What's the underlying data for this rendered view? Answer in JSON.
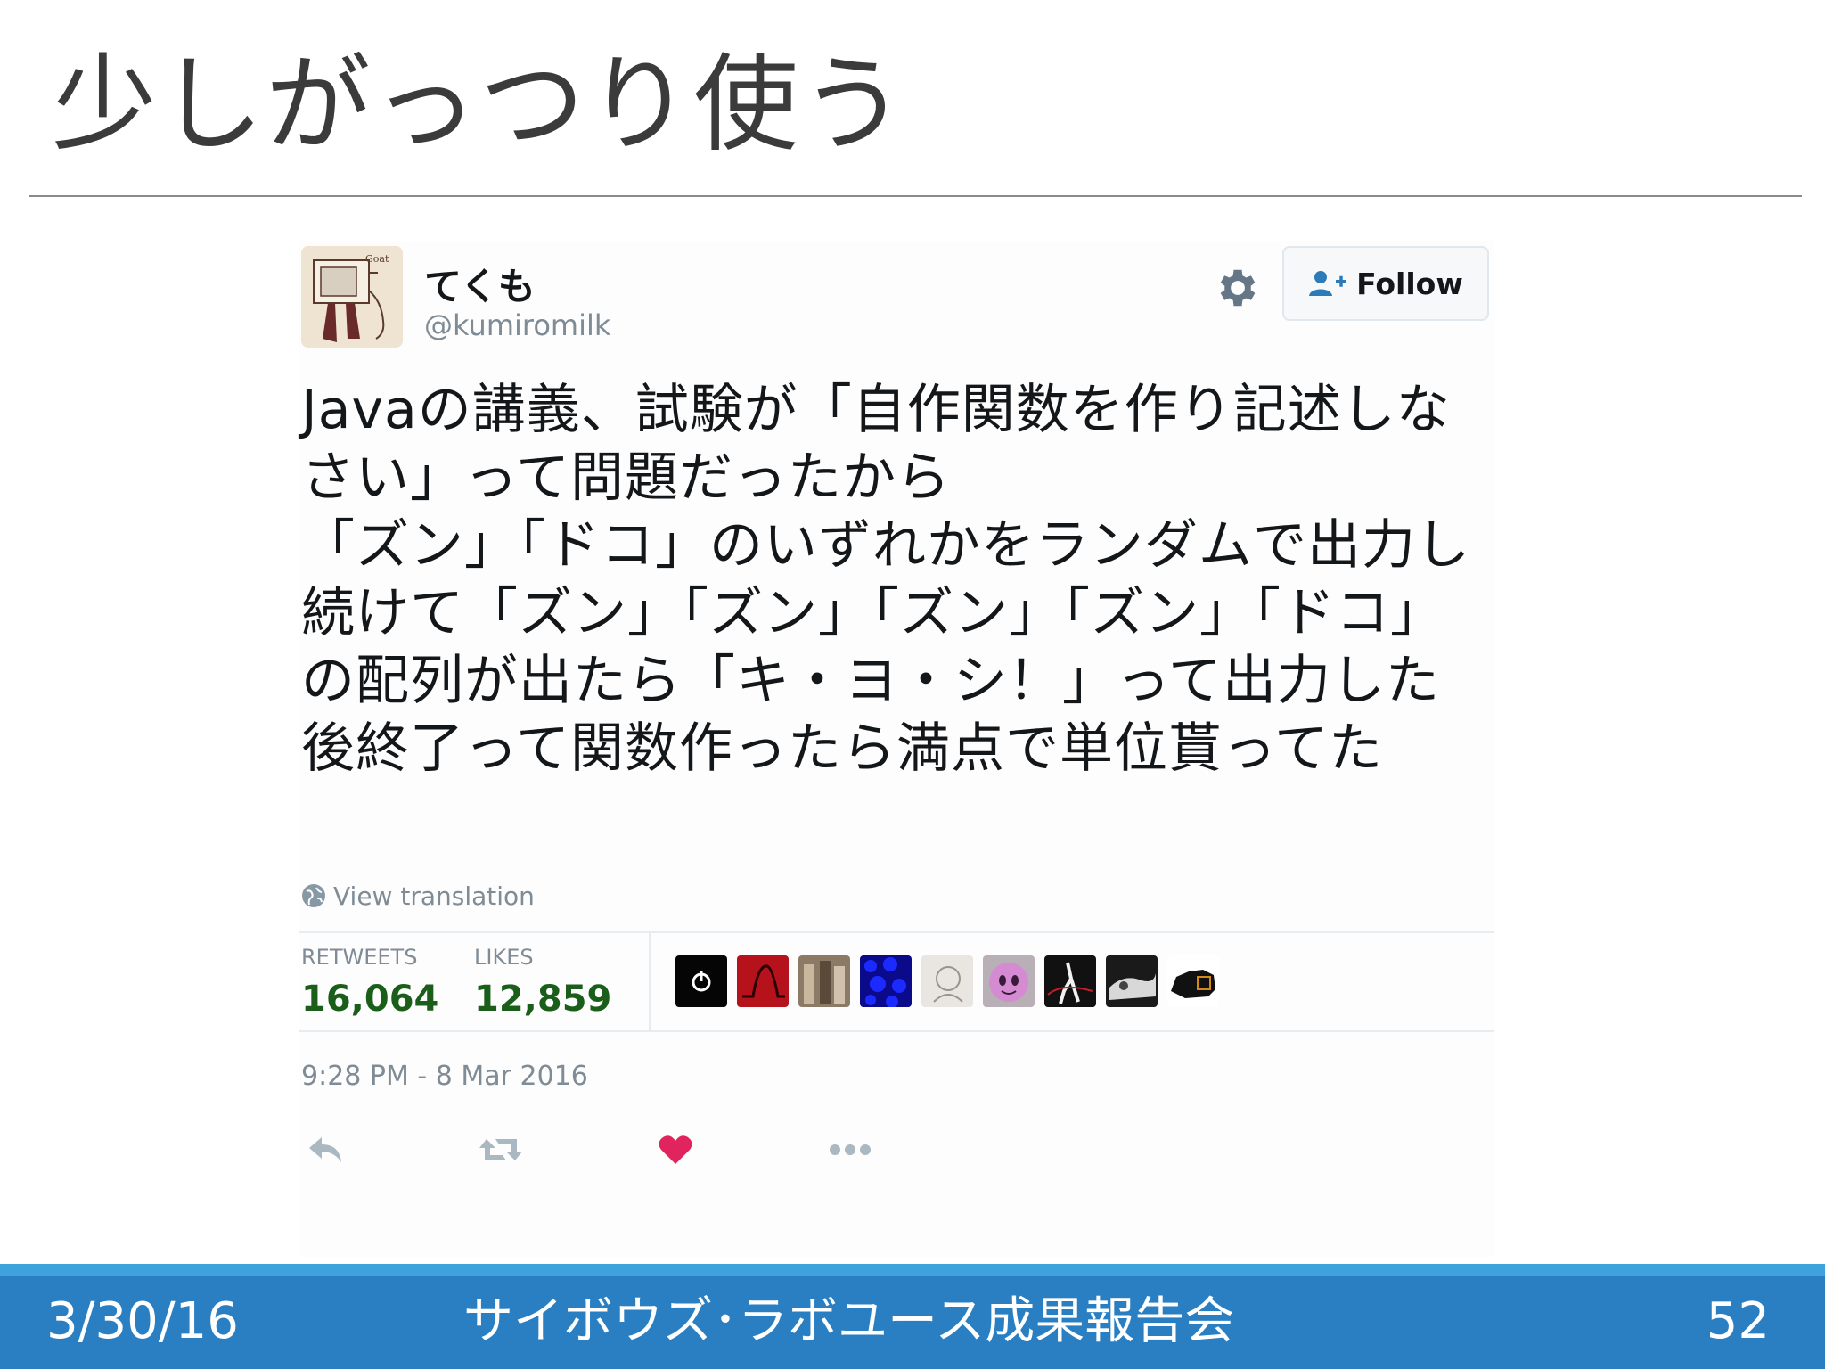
{
  "slide": {
    "title": "少しがっつり使う",
    "footer": {
      "date": "3/30/16",
      "center": "サイボウズ･ラボユース成果報告会",
      "page": "52"
    }
  },
  "tweet": {
    "display_name": "てくも",
    "handle": "@kumiromilk",
    "follow_label": "Follow",
    "text": "Javaの講義、試験が「自作関数を作り記述しなさい」って問題だったから\n「ズン」「ドコ」のいずれかをランダムで出力し続けて「ズン」「ズン」「ズン」「ズン」「ドコ」の配列が出たら「キ・ヨ・シ！」って出力した後終了って関数作ったら満点で単位貰ってた",
    "view_translation": "View translation",
    "stats": {
      "retweets_label": "RETWEETS",
      "retweets_value": "16,064",
      "likes_label": "LIKES",
      "likes_value": "12,859"
    },
    "timestamp": "9:28 PM - 8 Mar 2016",
    "icons": {
      "settings": "gear-icon",
      "follow": "add-user-icon",
      "translate": "globe-icon",
      "reply": "reply-icon",
      "retweet": "retweet-icon",
      "like": "heart-icon",
      "more": "more-icon"
    },
    "colors": {
      "follow_icon": "#2b7bb9",
      "like_heart": "#e0245e",
      "stat_value": "#1a5e1a",
      "muted": "#7f8b95"
    }
  }
}
